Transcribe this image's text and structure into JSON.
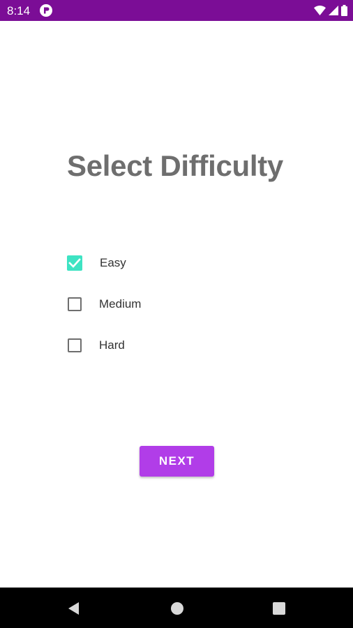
{
  "status_bar": {
    "time": "8:14",
    "background_color": "#7b0d96",
    "icons": [
      "app-notification-icon",
      "wifi-icon",
      "cellular-signal-icon",
      "battery-icon"
    ]
  },
  "screen": {
    "title": "Select Difficulty",
    "options": [
      {
        "label": "Easy",
        "checked": true
      },
      {
        "label": "Medium",
        "checked": false
      },
      {
        "label": "Hard",
        "checked": false
      }
    ],
    "next_button": {
      "label": "NEXT",
      "color": "#b13de8"
    },
    "checked_color": "#3ee3c3"
  },
  "nav_bar": {
    "buttons": [
      "back-icon",
      "home-icon",
      "recents-icon"
    ]
  }
}
